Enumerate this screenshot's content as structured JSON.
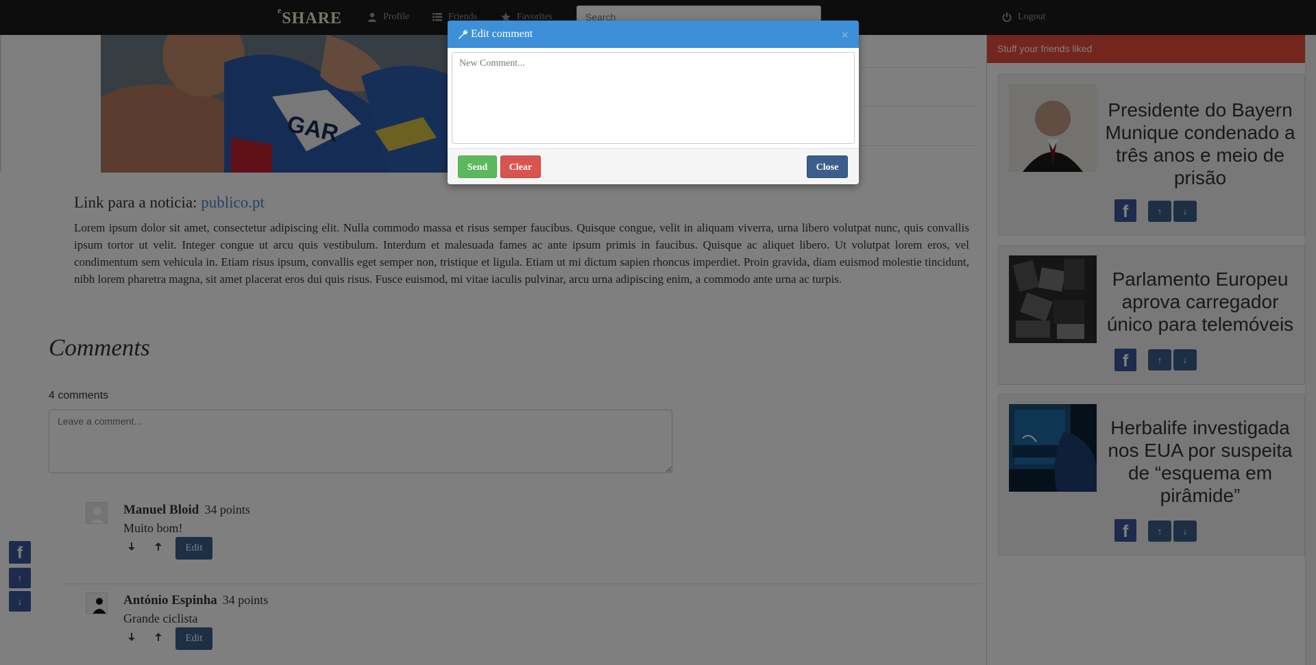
{
  "navbar": {
    "brand_prefix": "e",
    "brand": "SHARE",
    "profile": "Profile",
    "friends": "Friends",
    "favorites": "Favorites",
    "search_placeholder": "Search",
    "logout": "Logout"
  },
  "article": {
    "link_prefix": "Link para a noticia:",
    "link_text": "publico.pt",
    "body": "Lorem ipsum dolor sit amet, consectetur adipiscing elit. Nulla commodo massa et risus semper faucibus. Quisque congue, velit in aliquam viverra, urna libero volutpat nunc, quis convallis ipsum tortor ut velit. Integer congue ut arcu quis vestibulum. Interdum et malesuada fames ac ante ipsum primis in faucibus. Quisque ac aliquet libero. Ut volutpat lorem eros, vel condimentum sem vehicula in. Etiam risus ipsum, convallis eget semper non, tristique et ligula. Etiam ut mi dictum sapien rhoncus imperdiet. Proin gravida, diam euismod molestie tincidunt, nibh lorem pharetra magna, sit amet placerat eros dui quis risus. Fusce euismod, mi vitae iaculis pulvinar, arcu urna adipiscing enim, a commodo ante urna ac turpis."
  },
  "comments": {
    "title": "Comments",
    "count": "4 comments",
    "placeholder": "Leave a comment...",
    "items": [
      {
        "author": "Manuel Bloid",
        "points": "34 points",
        "text": "Muito bom!",
        "edit": "Edit"
      },
      {
        "author": "António Espinha",
        "points": "34 points",
        "text": "Grande ciclista",
        "edit": "Edit"
      }
    ]
  },
  "sidebar": {
    "header": "Stuff your friends liked",
    "cards": [
      {
        "title": "Presidente do Bayern Munique condenado a três anos e meio de prisão",
        "fb": "f",
        "up": "↑",
        "down": "↓"
      },
      {
        "title": "Parlamento Europeu aprova carregador único para telemóveis",
        "fb": "f",
        "up": "↑",
        "down": "↓"
      },
      {
        "title": "Herbalife investigada nos EUA por suspeita de “esquema em pirâmide”",
        "fb": "f",
        "up": "↑",
        "down": "↓"
      }
    ]
  },
  "side_share": {
    "fb": "f",
    "up": "↑",
    "down": "↓"
  },
  "modal": {
    "title": "Edit comment",
    "close_x": "×",
    "placeholder": "New Comment...",
    "send": "Send",
    "clear": "Clear",
    "close": "Close"
  },
  "colors": {
    "navbar": "#1b1b1b",
    "modal_header": "#3d8fd8",
    "sidebar_header": "#e74c3c",
    "send": "#5cb85c",
    "clear": "#d9534f",
    "primary": "#3b5f8a",
    "facebook": "#3b5998"
  }
}
